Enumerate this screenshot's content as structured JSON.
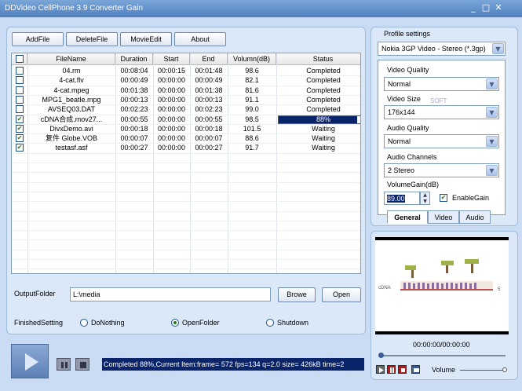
{
  "window": {
    "title": "DDVideo CellPhone 3.9 Converter Gain",
    "controls": [
      "_",
      "□",
      "✕"
    ]
  },
  "toolbar": {
    "add_file": "AddFile",
    "delete_file": "DeleteFile",
    "movie_edit": "MovieEdit",
    "about": "About"
  },
  "table": {
    "headers": [
      "FileName",
      "Duration",
      "Start",
      "End",
      "Volumn(dB)",
      "Status"
    ],
    "rows": [
      {
        "checked": false,
        "file": "04.rm",
        "duration": "00:08:04",
        "start": "00:00:15",
        "end": "00:01:48",
        "volume": "98.6",
        "status": "Completed"
      },
      {
        "checked": false,
        "file": "4-cat.flv",
        "duration": "00:00:49",
        "start": "00:00:00",
        "end": "00:00:49",
        "volume": "82.1",
        "status": "Completed"
      },
      {
        "checked": false,
        "file": "4-cat.mpeg",
        "duration": "00:01:38",
        "start": "00:00:00",
        "end": "00:01:38",
        "volume": "81.6",
        "status": "Completed"
      },
      {
        "checked": false,
        "file": "MPG1_beatle.mpg",
        "duration": "00:00:13",
        "start": "00:00:00",
        "end": "00:00:13",
        "volume": "91.1",
        "status": "Completed"
      },
      {
        "checked": false,
        "file": "AVSEQ03.DAT",
        "duration": "00:02:23",
        "start": "00:00:00",
        "end": "00:02:23",
        "volume": "99.0",
        "status": "Completed"
      },
      {
        "checked": true,
        "file": "cDNA合成.mov27...",
        "duration": "00:00:55",
        "start": "00:00:00",
        "end": "00:00:55",
        "volume": "98.5",
        "status": "88%",
        "progress": 0.88
      },
      {
        "checked": true,
        "file": "DivxDemo.avi",
        "duration": "00:00:18",
        "start": "00:00:00",
        "end": "00:00:18",
        "volume": "101.5",
        "status": "Waiting"
      },
      {
        "checked": true,
        "file": "复件 Globe.VOB",
        "duration": "00:00:07",
        "start": "00:00:00",
        "end": "00:00:07",
        "volume": "88.6",
        "status": "Waiting"
      },
      {
        "checked": true,
        "file": "testasf.asf",
        "duration": "00:00:27",
        "start": "00:00:00",
        "end": "00:00:27",
        "volume": "91.7",
        "status": "Waiting"
      }
    ]
  },
  "output": {
    "label": "OutputFolder",
    "value": "L:\\media",
    "browse": "Browe",
    "open": "Open"
  },
  "finished": {
    "label": "FinishedSetting",
    "options": [
      "DoNothing",
      "OpenFolder",
      "Shutdown"
    ],
    "selected_index": 1
  },
  "status_text": "Completed 88%,Current Item:frame=  572 fps=134 q=2.0 size=     426kB time=2",
  "profile": {
    "label": "Profile settings",
    "value": "Nokia 3GP Video - Stereo (*.3gp)"
  },
  "settings": {
    "video_quality_label": "Video Quality",
    "video_quality": "Normal",
    "video_size_label": "Video Size",
    "video_size": "176x144",
    "audio_quality_label": "Audio Quality",
    "audio_quality": "Normal",
    "audio_channels_label": "Audio Channels",
    "audio_channels": "2  Stereo",
    "volume_gain_label": "VolumeGain(dB)",
    "volume_gain": "89.00",
    "enable_gain_label": "EnableGain",
    "enable_gain": true
  },
  "tabs": [
    "General",
    "Video",
    "Audio"
  ],
  "preview": {
    "time": "00:00:00/00:00:00",
    "volume_label": "Volume",
    "caption_left": "cDNA",
    "caption_right": "5'",
    "watermark": "SOFT"
  }
}
